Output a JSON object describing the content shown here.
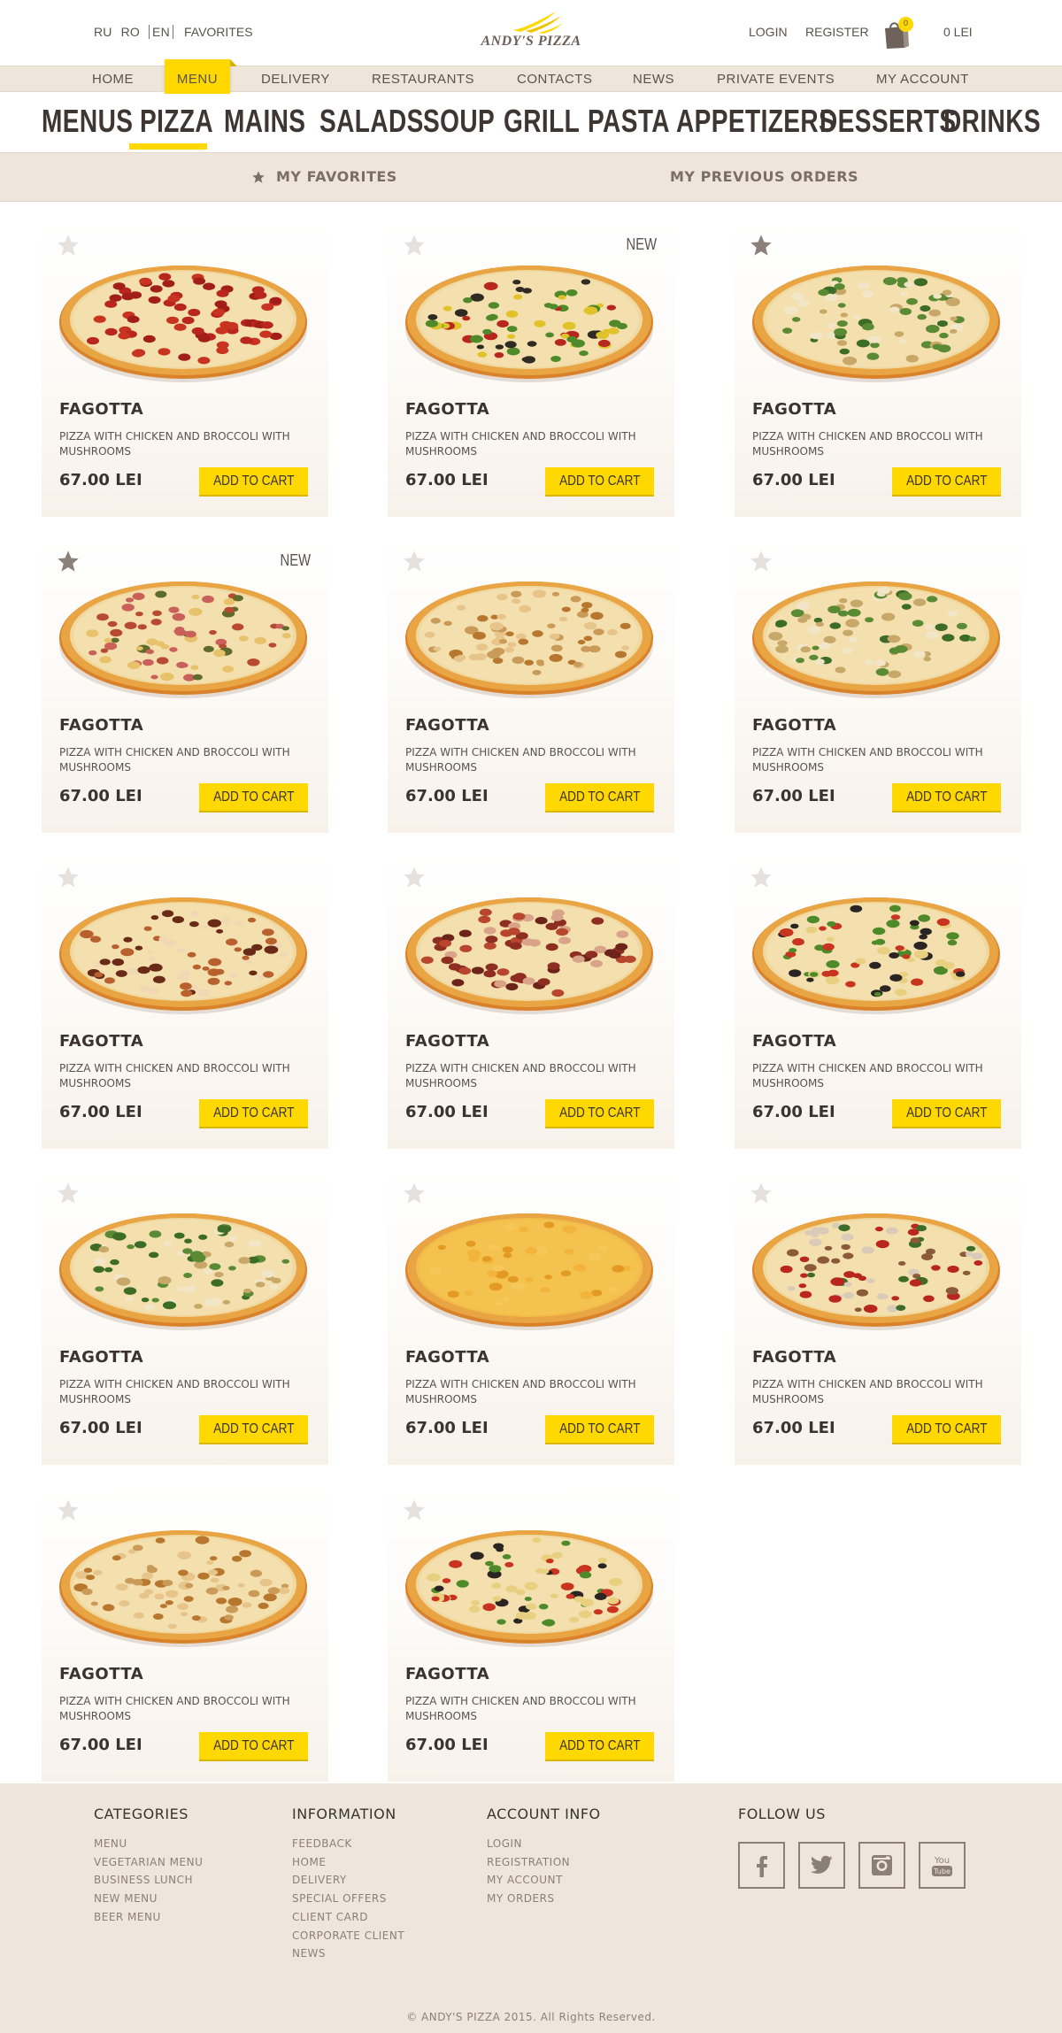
{
  "header": {
    "languages": [
      "RU",
      "RO",
      "EN"
    ],
    "active_language": "EN",
    "favorites_link": "FAVORITES",
    "logo_text": "ANDY'S PIZZA",
    "login": "LOGIN",
    "register": "REGISTER",
    "cart_count": "0",
    "cart_total": "0 LEI"
  },
  "main_nav": {
    "items": [
      "HOME",
      "MENU",
      "DELIVERY",
      "RESTAURANTS",
      "CONTACTS",
      "NEWS",
      "PRIVATE EVENTS",
      "MY ACCOUNT"
    ],
    "active": "MENU"
  },
  "category_nav": {
    "items": [
      "MENUS",
      "PIZZA",
      "MAINS",
      "SALADS",
      "SOUP",
      "GRILL",
      "PASTA",
      "APPETIZERS",
      "DESSERTS",
      "DRINKS"
    ],
    "active": "PIZZA"
  },
  "sub_nav": {
    "favorites": "MY FAVORITES",
    "previous_orders": "MY PREVIOUS ORDERS"
  },
  "products": [
    {
      "name": "FAGOTTA",
      "description": "PIZZA WITH CHICKEN AND BROCCOLI WITH MUSHROOMS",
      "price": "67.00 LEI",
      "button": "ADD TO CART",
      "favorite": false,
      "badge": "",
      "topping": "pepperoni"
    },
    {
      "name": "FAGOTTA",
      "description": "PIZZA WITH CHICKEN AND BROCCOLI WITH MUSHROOMS",
      "price": "67.00 LEI",
      "button": "ADD TO CART",
      "favorite": false,
      "badge": "NEW",
      "topping": "supreme"
    },
    {
      "name": "FAGOTTA",
      "description": "PIZZA WITH CHICKEN AND BROCCOLI WITH MUSHROOMS",
      "price": "67.00 LEI",
      "button": "ADD TO CART",
      "favorite": true,
      "badge": "",
      "topping": "spinach"
    },
    {
      "name": "FAGOTTA",
      "description": "PIZZA WITH CHICKEN AND BROCCOLI WITH MUSHROOMS",
      "price": "67.00 LEI",
      "button": "ADD TO CART",
      "favorite": true,
      "badge": "NEW",
      "topping": "ham"
    },
    {
      "name": "FAGOTTA",
      "description": "PIZZA WITH CHICKEN AND BROCCOLI WITH MUSHROOMS",
      "price": "67.00 LEI",
      "button": "ADD TO CART",
      "favorite": false,
      "badge": "",
      "topping": "chicken"
    },
    {
      "name": "FAGOTTA",
      "description": "PIZZA WITH CHICKEN AND BROCCOLI WITH MUSHROOMS",
      "price": "67.00 LEI",
      "button": "ADD TO CART",
      "favorite": false,
      "badge": "",
      "topping": "spinach"
    },
    {
      "name": "FAGOTTA",
      "description": "PIZZA WITH CHICKEN AND BROCCOLI WITH MUSHROOMS",
      "price": "67.00 LEI",
      "button": "ADD TO CART",
      "favorite": false,
      "badge": "",
      "topping": "bbq"
    },
    {
      "name": "FAGOTTA",
      "description": "PIZZA WITH CHICKEN AND BROCCOLI WITH MUSHROOMS",
      "price": "67.00 LEI",
      "button": "ADD TO CART",
      "favorite": false,
      "badge": "",
      "topping": "meat"
    },
    {
      "name": "FAGOTTA",
      "description": "PIZZA WITH CHICKEN AND BROCCOLI WITH MUSHROOMS",
      "price": "67.00 LEI",
      "button": "ADD TO CART",
      "favorite": false,
      "badge": "",
      "topping": "veggie"
    },
    {
      "name": "FAGOTTA",
      "description": "PIZZA WITH CHICKEN AND BROCCOLI WITH MUSHROOMS",
      "price": "67.00 LEI",
      "button": "ADD TO CART",
      "favorite": false,
      "badge": "",
      "topping": "spinach"
    },
    {
      "name": "FAGOTTA",
      "description": "PIZZA WITH CHICKEN AND BROCCOLI WITH MUSHROOMS",
      "price": "67.00 LEI",
      "button": "ADD TO CART",
      "favorite": false,
      "badge": "",
      "topping": "cheese"
    },
    {
      "name": "FAGOTTA",
      "description": "PIZZA WITH CHICKEN AND BROCCOLI WITH MUSHROOMS",
      "price": "67.00 LEI",
      "button": "ADD TO CART",
      "favorite": false,
      "badge": "",
      "topping": "mushroom"
    },
    {
      "name": "FAGOTTA",
      "description": "PIZZA WITH CHICKEN AND BROCCOLI WITH MUSHROOMS",
      "price": "67.00 LEI",
      "button": "ADD TO CART",
      "favorite": false,
      "badge": "",
      "topping": "chicken"
    },
    {
      "name": "FAGOTTA",
      "description": "PIZZA WITH CHICKEN AND BROCCOLI WITH MUSHROOMS",
      "price": "67.00 LEI",
      "button": "ADD TO CART",
      "favorite": false,
      "badge": "",
      "topping": "veggie"
    }
  ],
  "footer": {
    "categories": {
      "title": "CATEGORIES",
      "links": [
        "MENU",
        "VEGETARIAN MENU",
        "BUSINESS LUNCH",
        "NEW MENU",
        "BEER MENU"
      ]
    },
    "information": {
      "title": "INFORMATION",
      "links": [
        "FEEDBACK",
        "HOME",
        "DELIVERY",
        "SPECIAL OFFERS",
        "CLIENT CARD",
        "CORPORATE CLIENT",
        "NEWS"
      ]
    },
    "account": {
      "title": "ACCOUNT INFO",
      "links": [
        "LOGIN",
        "REGISTRATION",
        "MY ACCOUNT",
        "MY ORDERS"
      ]
    },
    "follow": {
      "title": "FOLLOW US",
      "networks": [
        "facebook-icon",
        "twitter-icon",
        "instagram-icon",
        "youtube-icon"
      ]
    },
    "copyright": "© ANDY'S PIZZA 2015. All Rights Reserved."
  },
  "colors": {
    "accent": "#ffd800",
    "beige": "#efe6db",
    "text": "#3a332e",
    "muted": "#8a8078"
  }
}
